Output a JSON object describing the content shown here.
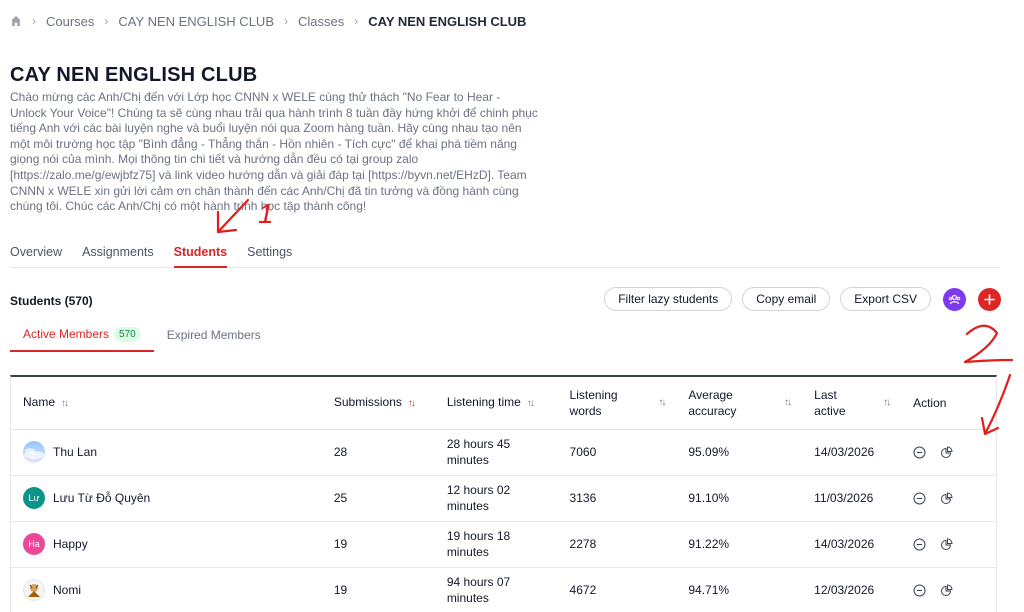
{
  "breadcrumb": {
    "items": [
      "Courses",
      "CAY NEN ENGLISH CLUB",
      "Classes",
      "CAY NEN ENGLISH CLUB"
    ]
  },
  "page": {
    "title": "CAY NEN ENGLISH CLUB",
    "description": "Chào mừng các Anh/Chị đến với Lớp học CNNN x WELE cùng thử thách \"No Fear to Hear - Unlock Your Voice\"! Chúng ta sẽ cùng nhau trải qua hành trình 8 tuần đầy hứng khởi để chinh phục tiếng Anh với các bài luyện nghe và buổi luyện nói qua Zoom hàng tuần. Hãy cùng nhau tạo nên một môi trường học tập \"Bình đẳng - Thẳng thắn - Hồn nhiên - Tích cực\" để khai phá tiềm năng giọng nói của mình. Mọi thông tin chi tiết và hướng dẫn đều có tại group zalo [https://zalo.me/g/ewjbfz75] và link video hướng dẫn và giải đáp tại [https://byvn.net/EHzD]. Team CNNN x WELE xin gửi lời cảm ơn chân thành đến các Anh/Chị đã tin tưởng và đồng hành cùng chúng tôi. Chúc các Anh/Chị có một hành trình học tập thành công!"
  },
  "tabs": [
    "Overview",
    "Assignments",
    "Students",
    "Settings"
  ],
  "students": {
    "title": "Students (570)",
    "buttons": {
      "filter": "Filter lazy students",
      "copy": "Copy email",
      "export": "Export CSV"
    },
    "subtabs": {
      "active": "Active Members",
      "active_count": "570",
      "expired": "Expired Members"
    }
  },
  "table": {
    "headers": {
      "name": "Name",
      "submissions": "Submissions",
      "listening_time": "Listening time",
      "listening_words_1": "Listening",
      "listening_words_2": "words",
      "accuracy_1": "Average",
      "accuracy_2": "accuracy",
      "last_active_1": "Last",
      "last_active_2": "active",
      "action": "Action"
    },
    "rows": [
      {
        "name": "Thu Lan",
        "initials": "",
        "submissions": "28",
        "time_1": "28 hours 45",
        "time_2": "minutes",
        "words": "7060",
        "accuracy": "95.09%",
        "last_active": "14/03/2026"
      },
      {
        "name": "Lưu Từ Đỗ Quyên",
        "initials": "Lư",
        "submissions": "25",
        "time_1": "12 hours 02",
        "time_2": "minutes",
        "words": "3136",
        "accuracy": "91.10%",
        "last_active": "11/03/2026"
      },
      {
        "name": "Happy",
        "initials": "Ha",
        "submissions": "19",
        "time_1": "19 hours 18",
        "time_2": "minutes",
        "words": "2278",
        "accuracy": "91.22%",
        "last_active": "14/03/2026"
      },
      {
        "name": "Nomi",
        "initials": "",
        "submissions": "19",
        "time_1": "94 hours 07",
        "time_2": "minutes",
        "words": "4672",
        "accuracy": "94.71%",
        "last_active": "12/03/2026"
      }
    ]
  },
  "annotations": {
    "label_1": "1",
    "label_2": "2"
  },
  "colors": {
    "accent": "#dc2626",
    "purple": "#7c3aed",
    "badge_bg": "#dcfce7",
    "badge_text": "#15803d",
    "avatar_teal": "#0d9488",
    "avatar_pink": "#ec4899"
  },
  "icons": {
    "home": "home-icon",
    "chevron": "chevron-right-icon",
    "group": "users-icon",
    "add": "plus-icon",
    "sort": "sort-icon",
    "remove": "minus-circle-icon",
    "stats": "pie-chart-icon"
  }
}
